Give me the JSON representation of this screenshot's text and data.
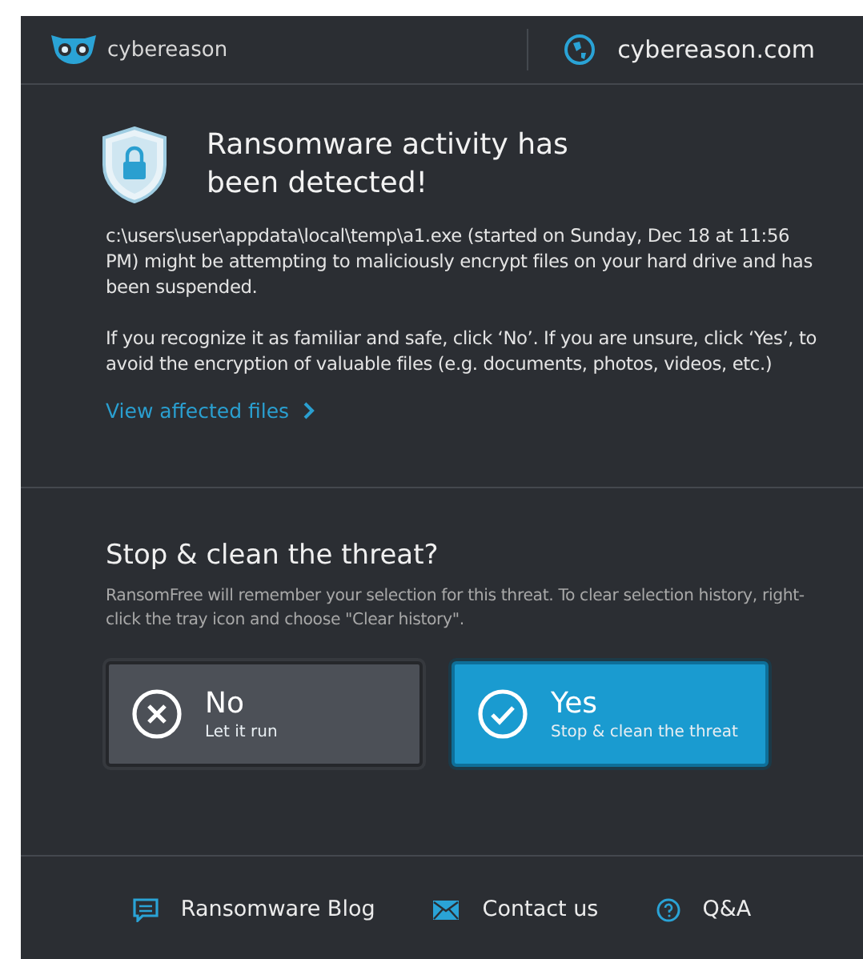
{
  "header": {
    "brand": "cybereason",
    "link": "cybereason.com"
  },
  "alert": {
    "title": "Ransomware activity has been detected!",
    "details": "c:\\users\\user\\appdata\\local\\temp\\a1.exe (started on Sunday, Dec 18 at 11:56 PM) might be attempting to maliciously encrypt files on your hard drive and has been suspended.",
    "advice": "If you recognize it as familiar and safe, click ‘No’. If you are unsure, click ‘Yes’, to avoid the encryption of valuable files (e.g. documents, photos, videos, etc.)",
    "link": "View affected files"
  },
  "decision": {
    "title": "Stop & clean the threat?",
    "note": "RansomFree will remember your selection for this threat. To clear selection history, right-click the tray icon and choose \"Clear history\".",
    "choices": [
      {
        "kind": "no",
        "label": "No",
        "sublabel": "Let it run",
        "selected": false
      },
      {
        "kind": "yes",
        "label": "Yes",
        "sublabel": "Stop & clean the threat",
        "selected": true
      }
    ]
  },
  "footer": [
    {
      "kind": "blog",
      "label": "Ransomware Blog"
    },
    {
      "kind": "contact",
      "label": "Contact us"
    },
    {
      "kind": "qa",
      "label": "Q&A"
    }
  ]
}
